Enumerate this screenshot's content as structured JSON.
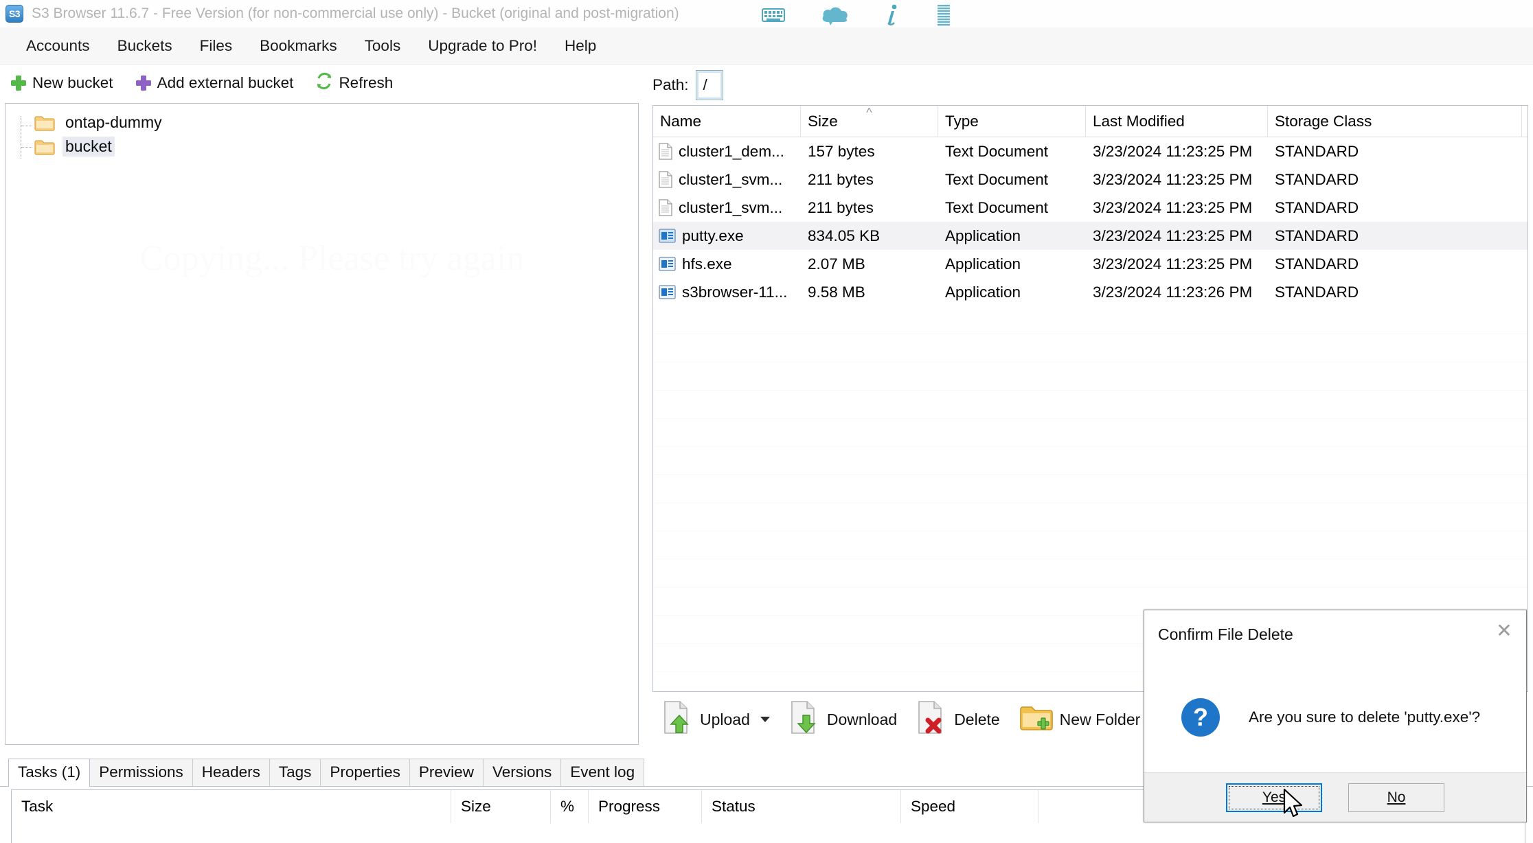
{
  "window": {
    "app_icon_text": "S3",
    "title": "S3 Browser 11.6.7 - Free Version (for non-commercial use only) - Bucket (original and post-migration)",
    "title_icons": [
      "keyboard-icon",
      "cloud-icon",
      "info-icon",
      "list-icon"
    ],
    "accent_color": "#4fa8bf"
  },
  "menubar": {
    "items": [
      {
        "label": "Accounts"
      },
      {
        "label": "Buckets"
      },
      {
        "label": "Files"
      },
      {
        "label": "Bookmarks"
      },
      {
        "label": "Tools"
      },
      {
        "label": "Upgrade to Pro!"
      },
      {
        "label": "Help"
      }
    ]
  },
  "bucket_toolbar": {
    "buttons": [
      {
        "label": "New bucket",
        "icon": "plus-icon",
        "color": "#54b948"
      },
      {
        "label": "Add external bucket",
        "icon": "plus-icon",
        "color": "#8e62c4"
      },
      {
        "label": "Refresh",
        "icon": "refresh-icon",
        "color": "#54b948"
      }
    ]
  },
  "tree": {
    "watermark": "Copying... Please try again",
    "items": [
      {
        "label": "ontap-dummy",
        "selected": false
      },
      {
        "label": "bucket",
        "selected": true
      }
    ]
  },
  "path": {
    "label": "Path:",
    "value": "/"
  },
  "filelist": {
    "columns": [
      "Name",
      "Size",
      "Type",
      "Last Modified",
      "Storage Class"
    ],
    "sorted_column": "Size",
    "sort_direction": "asc",
    "rows": [
      {
        "name": "cluster1_dem...",
        "size": "157 bytes",
        "type": "Text Document",
        "modified": "3/23/2024 11:23:25 PM",
        "storage": "STANDARD",
        "icon": "text-document-icon",
        "selected": false
      },
      {
        "name": "cluster1_svm...",
        "size": "211 bytes",
        "type": "Text Document",
        "modified": "3/23/2024 11:23:25 PM",
        "storage": "STANDARD",
        "icon": "text-document-icon",
        "selected": false
      },
      {
        "name": "cluster1_svm...",
        "size": "211 bytes",
        "type": "Text Document",
        "modified": "3/23/2024 11:23:25 PM",
        "storage": "STANDARD",
        "icon": "text-document-icon",
        "selected": false
      },
      {
        "name": "putty.exe",
        "size": "834.05 KB",
        "type": "Application",
        "modified": "3/23/2024 11:23:25 PM",
        "storage": "STANDARD",
        "icon": "application-icon",
        "selected": true
      },
      {
        "name": "hfs.exe",
        "size": "2.07 MB",
        "type": "Application",
        "modified": "3/23/2024 11:23:25 PM",
        "storage": "STANDARD",
        "icon": "application-icon",
        "selected": false
      },
      {
        "name": "s3browser-11...",
        "size": "9.58 MB",
        "type": "Application",
        "modified": "3/23/2024 11:23:26 PM",
        "storage": "STANDARD",
        "icon": "application-icon",
        "selected": false
      }
    ]
  },
  "file_actions": {
    "buttons": [
      {
        "label": "Upload",
        "icon": "upload-icon",
        "has_dropdown": true
      },
      {
        "label": "Download",
        "icon": "download-icon",
        "has_dropdown": false
      },
      {
        "label": "Delete",
        "icon": "delete-icon",
        "has_dropdown": false
      },
      {
        "label": "New Folder",
        "icon": "new-folder-icon",
        "has_dropdown": false
      }
    ]
  },
  "bottom_tabs": {
    "items": [
      {
        "label": "Tasks (1)",
        "active": true
      },
      {
        "label": "Permissions",
        "active": false
      },
      {
        "label": "Headers",
        "active": false
      },
      {
        "label": "Tags",
        "active": false
      },
      {
        "label": "Properties",
        "active": false
      },
      {
        "label": "Preview",
        "active": false
      },
      {
        "label": "Versions",
        "active": false
      },
      {
        "label": "Event log",
        "active": false
      }
    ]
  },
  "task_grid": {
    "columns": [
      "Task",
      "Size",
      "%",
      "Progress",
      "Status",
      "Speed"
    ],
    "rows": []
  },
  "dialog": {
    "title": "Confirm File Delete",
    "close_icon": "close-icon",
    "icon": "question-icon",
    "icon_glyph": "?",
    "icon_color": "#1f76c8",
    "message": "Are you sure to delete 'putty.exe'?",
    "buttons": [
      {
        "label": "Yes",
        "accel": "Y",
        "focused": true
      },
      {
        "label": "No",
        "accel": "N",
        "focused": false
      }
    ]
  }
}
